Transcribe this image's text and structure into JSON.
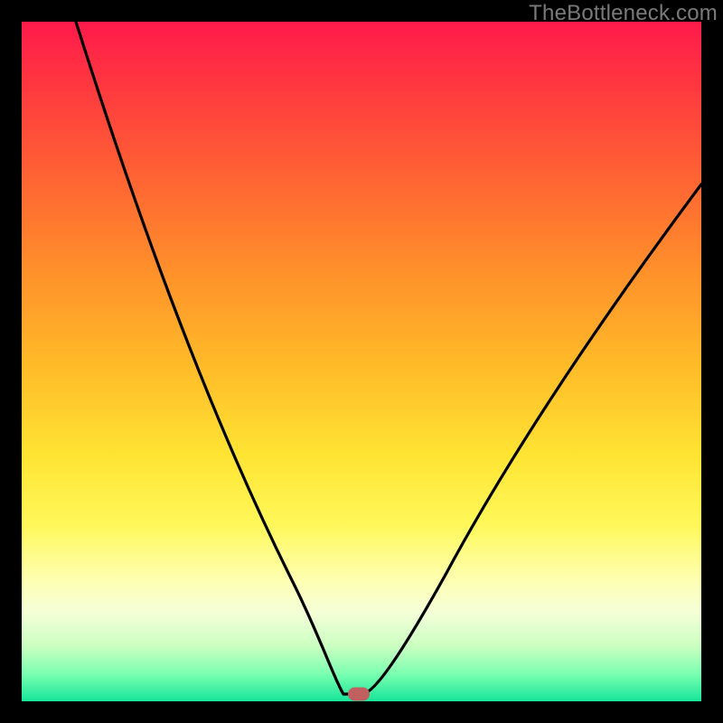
{
  "watermark": {
    "text": "TheBottleneck.com"
  },
  "colors": {
    "frame": "#000000",
    "curve": "#000000",
    "marker": "#c16060"
  },
  "chart_data": {
    "type": "line",
    "title": "",
    "xlabel": "",
    "ylabel": "",
    "xlim": [
      0,
      100
    ],
    "ylim": [
      0,
      100
    ],
    "x": [
      0,
      4,
      8,
      12,
      16,
      20,
      24,
      28,
      32,
      36,
      40,
      43,
      45,
      47,
      48,
      49,
      50,
      52,
      55,
      60,
      65,
      70,
      75,
      80,
      85,
      90,
      95,
      100
    ],
    "values": [
      100,
      91,
      82,
      73,
      64,
      55,
      46,
      38,
      30,
      22,
      15,
      10,
      6,
      3,
      1,
      0,
      0,
      2,
      6,
      14,
      23,
      32,
      41,
      49,
      57,
      64,
      71,
      77
    ],
    "marker": {
      "x": 49,
      "y": 0
    },
    "grid": false
  }
}
